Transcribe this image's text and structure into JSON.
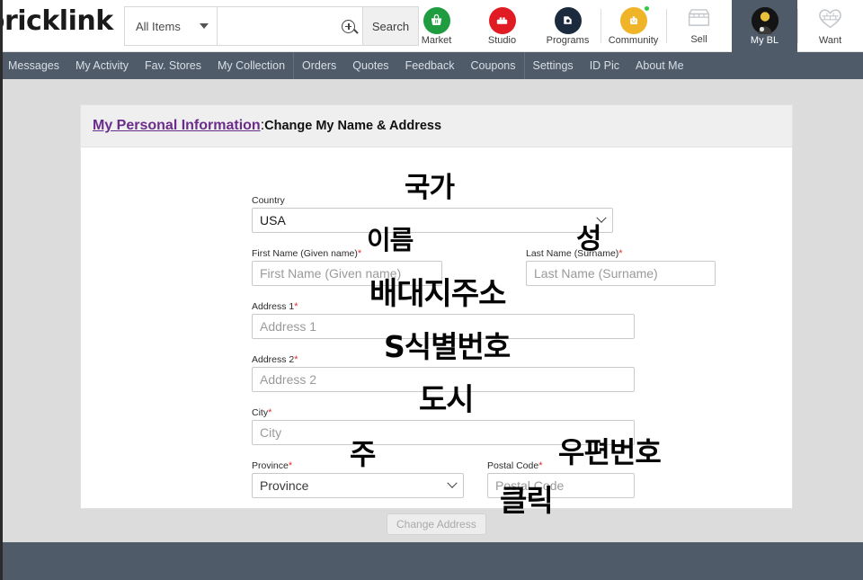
{
  "header": {
    "logo": "bricklink",
    "category_select": {
      "value": "All Items",
      "icon": "chevron-down-icon"
    },
    "search": {
      "value": "",
      "placeholder": "",
      "icon": "search-magnifier-icon"
    },
    "search_button": "Search",
    "nav": [
      {
        "label": "Market",
        "icon": "market-basket-icon",
        "color": "#1e9c3f",
        "active": false,
        "badge": false
      },
      {
        "label": "Studio",
        "icon": "studio-brick-icon",
        "color": "#e01b24",
        "active": false,
        "badge": false
      },
      {
        "label": "Programs",
        "icon": "programs-bag-icon",
        "color": "#1b2a3d",
        "active": false,
        "badge": false
      },
      {
        "label": "Community",
        "icon": "community-minifig-icon",
        "color": "#f0b429",
        "active": false,
        "badge": true
      },
      {
        "label": "Sell",
        "icon": "sell-store-icon",
        "color": "#b8b8b8",
        "active": false,
        "badge": false
      },
      {
        "label": "My BL",
        "icon": "my-bl-avatar-icon",
        "color": "#1a1a1a",
        "active": true,
        "badge": false
      },
      {
        "label": "Want",
        "icon": "want-heart-brick-icon",
        "color": "#b8b8b8",
        "active": false,
        "badge": false
      }
    ]
  },
  "subnav": {
    "group_left": [
      "Messages",
      "My Activity",
      "Fav. Stores",
      "My Collection"
    ],
    "group_mid": [
      "Orders",
      "Quotes",
      "Feedback",
      "Coupons"
    ],
    "group_right": [
      "Settings",
      "ID Pic",
      "About Me"
    ]
  },
  "panel": {
    "breadcrumb_link": "My Personal Information",
    "breadcrumb_sep": ": ",
    "title": "Change My Name & Address"
  },
  "form": {
    "country": {
      "label": "Country",
      "value": "USA",
      "required": false,
      "type": "select"
    },
    "first_name": {
      "label": "First Name (Given name)",
      "placeholder": "First Name (Given name)",
      "value": "",
      "required": true,
      "type": "text"
    },
    "last_name": {
      "label": "Last Name (Surname)",
      "placeholder": "Last Name (Surname)",
      "value": "",
      "required": true,
      "type": "text"
    },
    "address1": {
      "label": "Address 1",
      "placeholder": "Address 1",
      "value": "",
      "required": true,
      "type": "text"
    },
    "address2": {
      "label": "Address 2",
      "placeholder": "Address 2",
      "value": "",
      "required": true,
      "type": "text"
    },
    "city": {
      "label": "City",
      "placeholder": "City",
      "value": "",
      "required": true,
      "type": "text"
    },
    "province": {
      "label": "Province",
      "value": "Province",
      "required": true,
      "type": "select"
    },
    "postal_code": {
      "label": "Postal Code",
      "placeholder": "Postal Code",
      "value": "",
      "required": true,
      "type": "text"
    },
    "submit_button": {
      "label": "Change Address",
      "disabled": true
    },
    "required_mark": "*"
  },
  "annotations": {
    "country": "국가",
    "first_name": "이름",
    "last_name": "성",
    "address1": "배대지주소",
    "address2": "S식별번호",
    "city": "도시",
    "province": "주",
    "postal_code": "우편번호",
    "submit": "클릭"
  },
  "colors": {
    "nav_slate": "#4f5b69",
    "page_bg": "#dcdcdc",
    "panel_bg": "#ffffff",
    "panel_head_bg": "#efefef",
    "link_purple": "#6b2d8b",
    "required_red": "#e03030",
    "annotation_black": "#050505"
  }
}
